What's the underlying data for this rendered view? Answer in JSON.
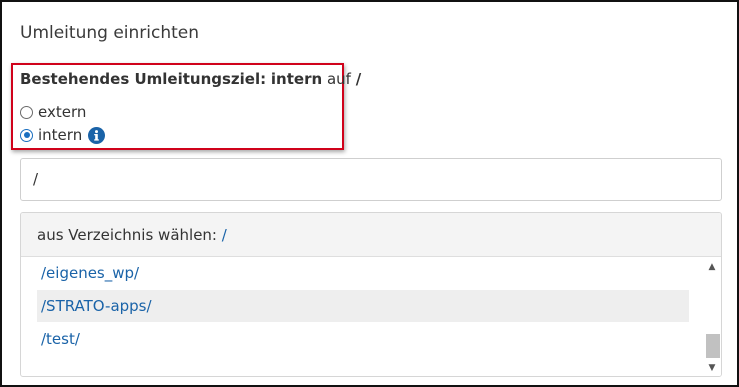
{
  "section": {
    "title": "Umleitung einrichten"
  },
  "target": {
    "label": "Bestehendes Umleitungsziel:",
    "type": "intern",
    "connector": "auf",
    "path": "/"
  },
  "radios": [
    {
      "label": "extern",
      "checked": false
    },
    {
      "label": "intern",
      "checked": true
    }
  ],
  "info_icon": "info-circle-icon",
  "path_input": {
    "value": "/"
  },
  "directory": {
    "header_label": "aus Verzeichnis wählen:",
    "current": "/",
    "items": [
      {
        "label": "/eigenes_wp/"
      },
      {
        "label": "/STRATO-apps/"
      },
      {
        "label": "/test/"
      }
    ],
    "highlighted_index": 1
  },
  "colors": {
    "accent": "#1a63a8",
    "highlight_border": "#d0021b"
  }
}
